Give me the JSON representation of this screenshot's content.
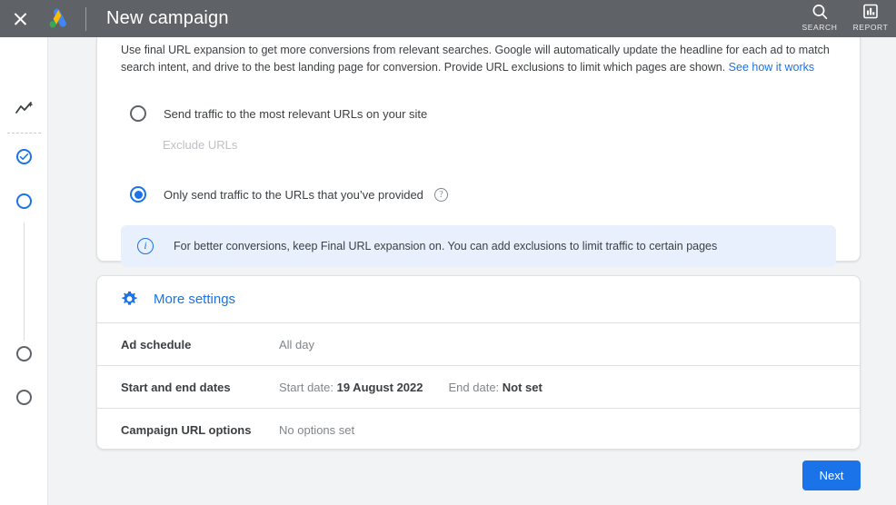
{
  "appbar": {
    "close_icon": "close-icon",
    "logo_icon": "google-ads-logo",
    "title": "New campaign",
    "actions": [
      {
        "icon": "search-icon",
        "label": "SEARCH"
      },
      {
        "icon": "report-bar-chart-icon",
        "label": "REPORT"
      }
    ]
  },
  "rail": {
    "items": [
      {
        "name": "insights-icon",
        "state": "icon"
      },
      {
        "name": "step-completed",
        "state": "checked"
      },
      {
        "name": "step-current",
        "state": "active"
      },
      {
        "name": "step-upcoming-1",
        "state": "inactive"
      },
      {
        "name": "step-upcoming-2",
        "state": "inactive"
      }
    ]
  },
  "final_url_expansion": {
    "description_part1": "Use final URL expansion to get more conversions from relevant searches. Google will automatically update the headline for each ad to match search intent, and drive to the best landing page for conversion. Provide URL exclusions to limit which pages are shown. ",
    "description_link": "See how it works",
    "option_1_label": "Send traffic to the most relevant URLs on your site",
    "exclude_urls_label": "Exclude URLs",
    "option_2_label": "Only send traffic to the URLs that you’ve provided",
    "help_glyph": "?",
    "selected_option": 2,
    "info_glyph": "i",
    "info_text": "For better conversions, keep Final URL expansion on. You can add exclusions to limit traffic to certain pages"
  },
  "more_settings": {
    "header_icon": "gear-icon",
    "header_label": "More settings",
    "rows": [
      {
        "label": "Ad schedule",
        "value": "All day",
        "value_parts": null
      },
      {
        "label": "Start and end dates",
        "value": null,
        "value_parts": [
          {
            "prefix": "Start date: ",
            "value": "19 August 2022"
          },
          {
            "prefix": "End date: ",
            "value": "Not set"
          }
        ]
      },
      {
        "label": "Campaign URL options",
        "value": "No options set",
        "value_parts": null
      }
    ]
  },
  "footer": {
    "next_label": "Next"
  },
  "colors": {
    "appbar_bg": "#5f6368",
    "accent_blue": "#1a73e8",
    "info_bg": "#e8f0fe",
    "page_bg": "#f1f3f4"
  }
}
